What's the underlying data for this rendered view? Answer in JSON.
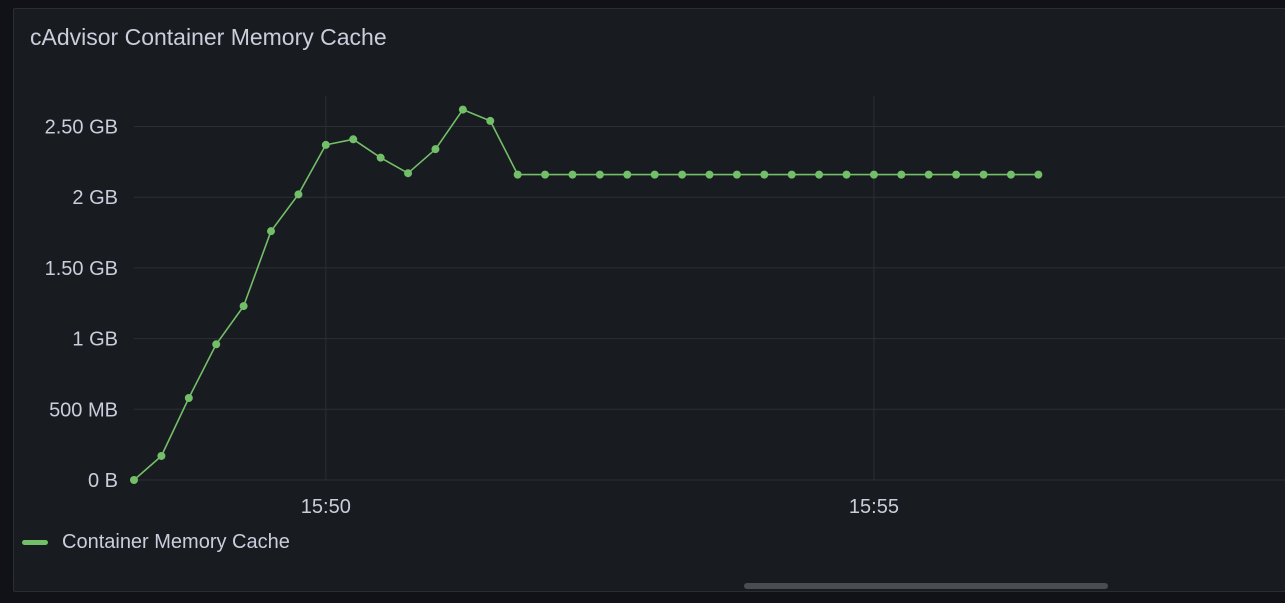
{
  "panel": {
    "title": "cAdvisor Container Memory Cache"
  },
  "colors": {
    "series": "#73bf69",
    "grid": "#2c2f35",
    "text": "#ccccdc"
  },
  "chart_data": {
    "type": "line",
    "title": "cAdvisor Container Memory Cache",
    "xlabel": "",
    "ylabel": "",
    "x_tick_labels": [
      "15:50",
      "15:55"
    ],
    "y_tick_labels": [
      "0 B",
      "500 MB",
      "1 GB",
      "1.50 GB",
      "2 GB",
      "2.50 GB"
    ],
    "y_ticks": [
      0,
      0.5,
      1,
      1.5,
      2,
      2.5
    ],
    "ylim": [
      0,
      2.9
    ],
    "xlim": [
      "15:48:15",
      "15:58:45"
    ],
    "grid": true,
    "legend_position": "bottom-left",
    "x": [
      "15:48:15",
      "15:48:30",
      "15:48:45",
      "15:49:00",
      "15:49:15",
      "15:49:30",
      "15:49:45",
      "15:50:00",
      "15:50:15",
      "15:50:30",
      "15:50:45",
      "15:51:00",
      "15:51:15",
      "15:51:30",
      "15:51:45",
      "15:52:00",
      "15:52:15",
      "15:52:30",
      "15:52:45",
      "15:53:00",
      "15:53:15",
      "15:53:30",
      "15:53:45",
      "15:54:00",
      "15:54:15",
      "15:54:30",
      "15:54:45",
      "15:55:00",
      "15:55:15",
      "15:55:30",
      "15:55:45",
      "15:56:00",
      "15:56:15",
      "15:56:30"
    ],
    "series": [
      {
        "name": "Container Memory Cache",
        "values": [
          0,
          0.17,
          0.58,
          0.96,
          1.23,
          1.76,
          2.02,
          2.37,
          2.41,
          2.28,
          2.17,
          2.34,
          2.62,
          2.54,
          2.16,
          2.16,
          2.16,
          2.16,
          2.16,
          2.16,
          2.16,
          2.16,
          2.16,
          2.16,
          2.16,
          2.16,
          2.16,
          2.16,
          2.16,
          2.16,
          2.16,
          2.16,
          2.16,
          2.16
        ]
      }
    ]
  }
}
